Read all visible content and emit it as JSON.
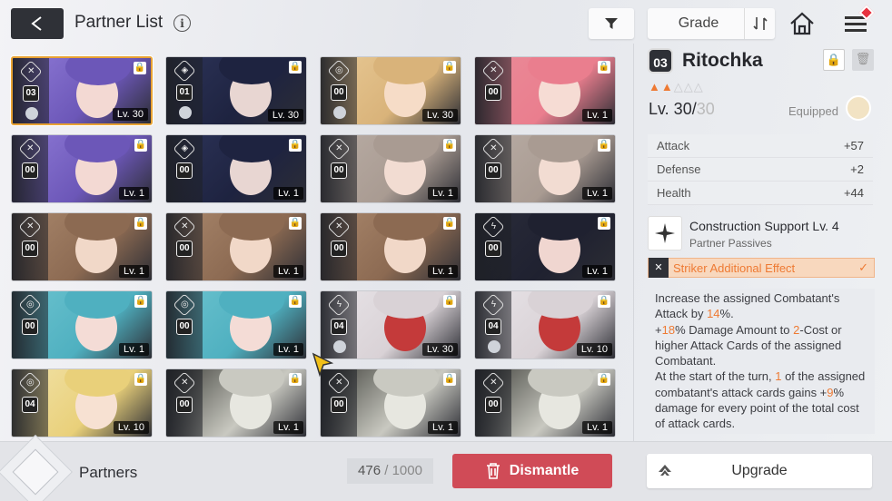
{
  "header": {
    "title": "Partner List",
    "info_glyph": "i",
    "sort_label": "Grade"
  },
  "cards": [
    {
      "rank": "03",
      "level": "Lv. 30",
      "icon": "cross-swords",
      "hue": "#8e7ad6",
      "hair": "#6c57b8",
      "skin": "#f3d9d3",
      "mini": true,
      "selected": true
    },
    {
      "rank": "01",
      "level": "Lv. 30",
      "icon": "shield",
      "hue": "#2d3459",
      "hair": "#1e2340",
      "skin": "#e8d6d2",
      "mini": true
    },
    {
      "rank": "00",
      "level": "Lv. 30",
      "icon": "circle",
      "hue": "#e8c995",
      "hair": "#d9b37a",
      "skin": "#f6dcc7",
      "mini": true
    },
    {
      "rank": "00",
      "level": "Lv. 1",
      "icon": "cross-swords",
      "hue": "#e98b98",
      "hair": "#ea7e8e",
      "skin": "#f6dcd4"
    },
    {
      "rank": "00",
      "level": "Lv. 1",
      "icon": "cross-swords",
      "hue": "#8e7ad6",
      "hair": "#6c57b8",
      "skin": "#f3d9d3"
    },
    {
      "rank": "00",
      "level": "Lv. 1",
      "icon": "shield",
      "hue": "#2d3459",
      "hair": "#1e2340",
      "skin": "#e8d6d2"
    },
    {
      "rank": "00",
      "level": "Lv. 1",
      "icon": "cross-swords",
      "hue": "#b9ada5",
      "hair": "#a99b92",
      "skin": "#f2dcd2"
    },
    {
      "rank": "00",
      "level": "Lv. 1",
      "icon": "cross-swords",
      "hue": "#b9ada5",
      "hair": "#a99b92",
      "skin": "#f2dcd2"
    },
    {
      "rank": "00",
      "level": "Lv. 1",
      "icon": "cross-swords",
      "hue": "#a9876c",
      "hair": "#8c6a52",
      "skin": "#f1d8c8"
    },
    {
      "rank": "00",
      "level": "Lv. 1",
      "icon": "cross-swords",
      "hue": "#a9876c",
      "hair": "#8c6a52",
      "skin": "#f1d8c8"
    },
    {
      "rank": "00",
      "level": "Lv. 1",
      "icon": "cross-swords",
      "hue": "#a9876c",
      "hair": "#8c6a52",
      "skin": "#f1d8c8"
    },
    {
      "rank": "00",
      "level": "Lv. 1",
      "icon": "lightning",
      "hue": "#2a2c3a",
      "hair": "#1f2130",
      "skin": "#f0d6d0"
    },
    {
      "rank": "00",
      "level": "Lv. 1",
      "icon": "circle",
      "hue": "#6cc3cf",
      "hair": "#4fb0c0",
      "skin": "#f4dcd6"
    },
    {
      "rank": "00",
      "level": "Lv. 1",
      "icon": "circle",
      "hue": "#6cc3cf",
      "hair": "#4fb0c0",
      "skin": "#f4dcd6"
    },
    {
      "rank": "04",
      "level": "Lv. 30",
      "icon": "lightning",
      "hue": "#e8e4e8",
      "hair": "#d9d2d6",
      "skin": "#c43a3a",
      "mini": true
    },
    {
      "rank": "04",
      "level": "Lv. 10",
      "icon": "lightning",
      "hue": "#e8e4e8",
      "hair": "#d9d2d6",
      "skin": "#c43a3a",
      "mini": true
    },
    {
      "rank": "04",
      "level": "Lv. 10",
      "icon": "circle",
      "hue": "#f1e2a8",
      "hair": "#e9d07a",
      "skin": "#f7e1d2"
    },
    {
      "rank": "00",
      "level": "Lv. 1",
      "icon": "cross-swords",
      "hue": "#3c3d38",
      "hair": "#c9c9c1",
      "skin": "#e7e7e0"
    },
    {
      "rank": "00",
      "level": "Lv. 1",
      "icon": "cross-swords",
      "hue": "#3c3d38",
      "hair": "#c9c9c1",
      "skin": "#e7e7e0"
    },
    {
      "rank": "00",
      "level": "Lv. 1",
      "icon": "cross-swords",
      "hue": "#3c3d38",
      "hair": "#c9c9c1",
      "skin": "#e7e7e0"
    }
  ],
  "detail": {
    "rank": "03",
    "name": "Ritochka",
    "stars_filled": "▲▲",
    "stars_empty": "△△△",
    "level": "Lv. 30/",
    "level_max": "30",
    "equipped": "Equipped",
    "stats": [
      {
        "label": "Attack",
        "value": "+57"
      },
      {
        "label": "Defense",
        "value": "+2"
      },
      {
        "label": "Health",
        "value": "+44"
      }
    ],
    "passive_title": "Construction Support Lv. 4",
    "passive_sub": "Partner Passives",
    "effect": "Striker Additional Effect",
    "check": "✓",
    "desc": [
      {
        "t": "Increase the assigned Combatant's Attack by "
      },
      {
        "t": "14",
        "o": true
      },
      {
        "t": "%."
      },
      {
        "br": true
      },
      {
        "t": "+"
      },
      {
        "t": "18",
        "o": true
      },
      {
        "t": "% Damage Amount to "
      },
      {
        "t": "2",
        "o": true
      },
      {
        "t": "-Cost or higher Attack Cards of the assigned Combatant."
      },
      {
        "br": true
      },
      {
        "t": "At the start of the turn, "
      },
      {
        "t": "1",
        "o": true
      },
      {
        "t": " of the assigned combatant's attack cards gains +"
      },
      {
        "t": "9",
        "o": true
      },
      {
        "t": "% damage for every point of the total cost of attack cards."
      }
    ]
  },
  "footer": {
    "label": "Partners",
    "count": "476",
    "sep": " / ",
    "total": "1000",
    "dismantle": "Dismantle",
    "upgrade": "Upgrade"
  },
  "colors": {
    "accent": "#ee7a33",
    "dismantle": "#d04b57",
    "selected": "#e8a233"
  }
}
